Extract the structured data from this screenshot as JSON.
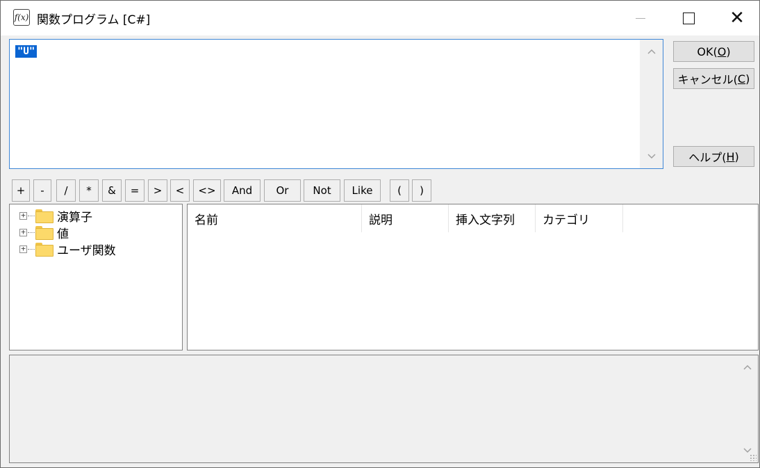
{
  "window": {
    "title": "関数プログラム [C#]",
    "icon": "function-icon",
    "icon_text": "f(x)",
    "minimize_symbol": "—",
    "maximize_symbol": "□",
    "close_symbol": "✕"
  },
  "editor": {
    "expression": "\"U\"",
    "scroll_up": "^",
    "scroll_down": "v"
  },
  "buttons": {
    "ok": {
      "label": "OK(",
      "key": "O",
      "suffix": ")"
    },
    "cancel": {
      "label": "キャンセル(",
      "key": "C",
      "suffix": ")"
    },
    "help": {
      "label": "ヘルプ(",
      "key": "H",
      "suffix": ")"
    }
  },
  "operators": [
    "+",
    "-",
    "/",
    "*",
    "&",
    "=",
    ">",
    "<",
    "<>",
    "And",
    "Or",
    "Not",
    "Like",
    "(",
    ")"
  ],
  "tree": {
    "items": [
      {
        "label": "演算子",
        "expander": "+"
      },
      {
        "label": "値",
        "expander": "+"
      },
      {
        "label": "ユーザ関数",
        "expander": "+"
      }
    ]
  },
  "list": {
    "columns": [
      "名前",
      "説明",
      "挿入文字列",
      "カテゴリ"
    ]
  },
  "description": {
    "scroll_up": "^",
    "scroll_down": "v"
  },
  "colors": {
    "selection": "#0a64d2",
    "focus_border": "#3d86d6",
    "folder": "#fcd96a",
    "background": "#f0f0f0"
  }
}
